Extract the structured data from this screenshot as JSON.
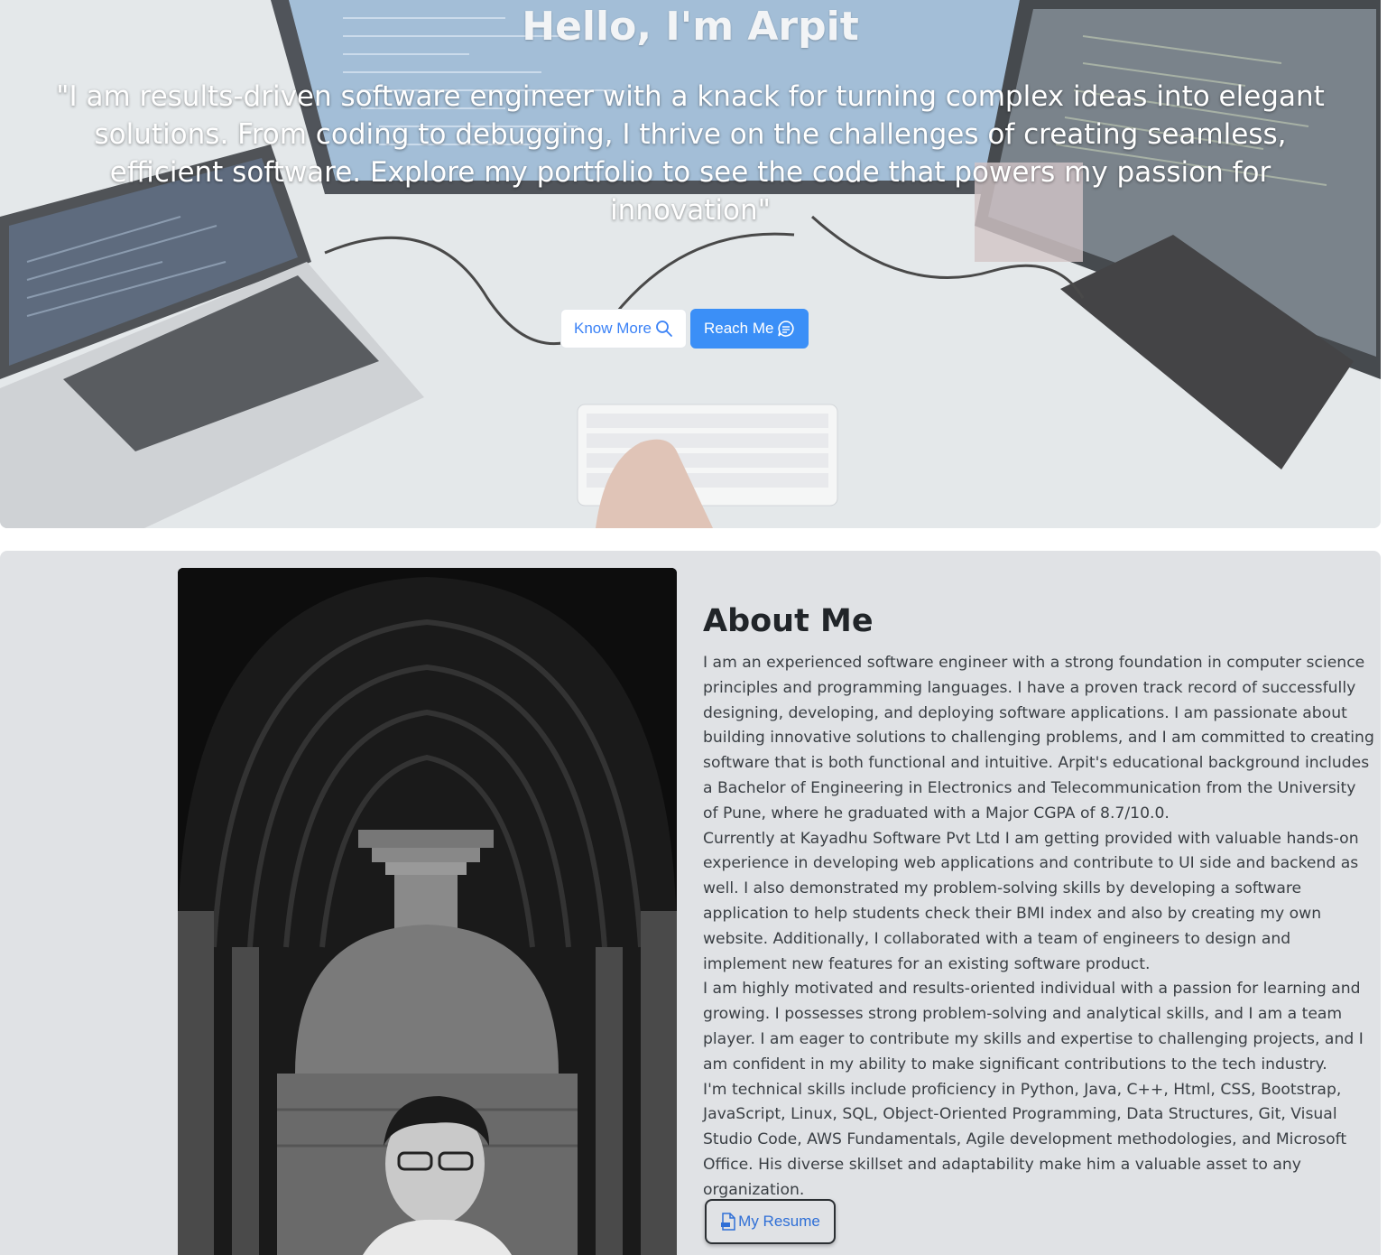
{
  "hero": {
    "title": "Hello, I'm Arpit",
    "quote": "\"I am results-driven software engineer with a knack for turning complex ideas into elegant solutions. From coding to debugging, I thrive on the challenges of creating seamless, efficient software. Explore my portfolio to see the code that powers my passion for innovation\"",
    "buttons": {
      "know_more": {
        "label": "Know More",
        "icon": "search-icon"
      },
      "reach_me": {
        "label": "Reach Me",
        "icon": "chat-icon"
      }
    },
    "background": "desk with laptop, monitors and keyboard"
  },
  "about": {
    "title": "About Me",
    "paragraphs": [
      "I am an experienced software engineer with a strong foundation in computer science principles and programming languages. I have a proven track record of successfully designing, developing, and deploying software applications. I am passionate about building innovative solutions to challenging problems, and I am committed to creating software that is both functional and intuitive. Arpit's educational background includes a Bachelor of Engineering in Electronics and Telecommunication from the University of Pune, where he graduated with a Major CGPA of 8.7/10.0.",
      "Currently at Kayadhu Software Pvt Ltd I am getting provided with valuable hands-on experience in developing web applications and contribute to UI side and backend as well. I also demonstrated my problem-solving skills by developing a software application to help students check their BMI index and also by creating my own website. Additionally, I collaborated with a team of engineers to design and implement new features for an existing software product.",
      "I am highly motivated and results-oriented individual with a passion for learning and growing. I possesses strong problem-solving and analytical skills, and I am a team player. I am eager to contribute my skills and expertise to challenging projects, and I am confident in my ability to make significant contributions to the tech industry.",
      "I'm technical skills include proficiency in Python, Java, C++, Html, CSS, Bootstrap, JavaScript, Linux, SQL, Object-Oriented Programming, Data Structures, Git, Visual Studio Code, AWS Fundamentals, Agile development methodologies, and Microsoft Office. His diverse skillset and adaptability make him a valuable asset to any organization."
    ],
    "resume_button": {
      "label": "My Resume",
      "icon": "pdf-file-icon"
    }
  },
  "colors": {
    "primary": "#3b8ff7",
    "about_background": "#e0e2e5",
    "text": "#212529"
  }
}
